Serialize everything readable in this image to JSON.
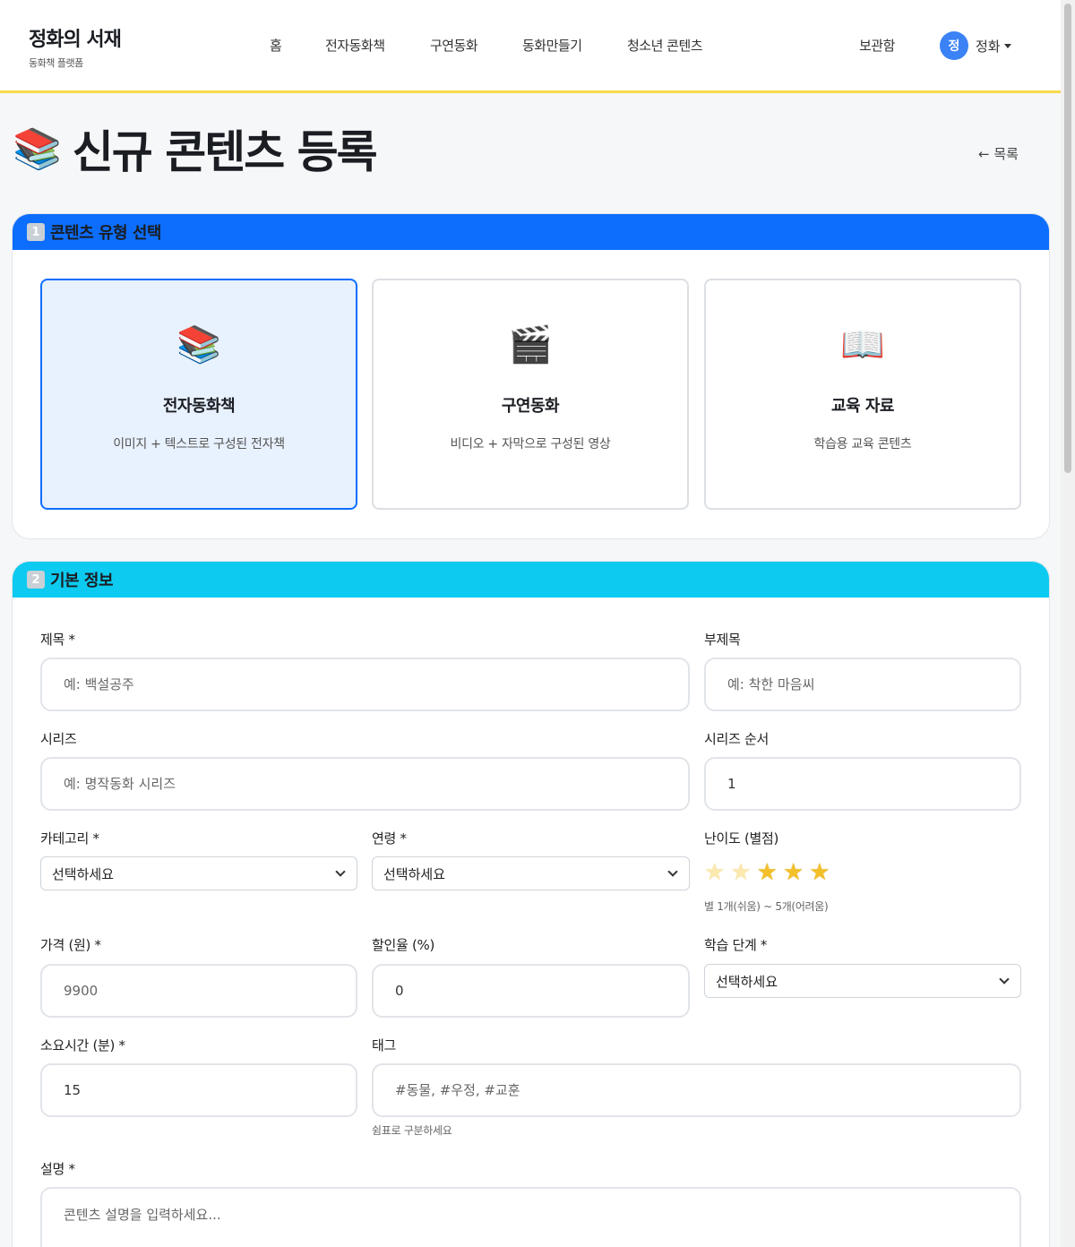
{
  "header": {
    "brand_title": "정화의 서재",
    "brand_subtitle": "동화책 플랫폼",
    "nav": [
      "홈",
      "전자동화책",
      "구연동화",
      "동화만들기",
      "청소년 콘텐츠"
    ],
    "storage": "보관함",
    "user_initial": "정",
    "user_name": "정화"
  },
  "page": {
    "title_icon": "📚",
    "title": "신규 콘텐츠 등록",
    "back_link": "← 목록"
  },
  "section1": {
    "number": "1",
    "title": "콘텐츠 유형 선택",
    "types": [
      {
        "icon": "📚",
        "title": "전자동화책",
        "desc": "이미지 + 텍스트로 구성된 전자책",
        "selected": true
      },
      {
        "icon": "🎬",
        "title": "구연동화",
        "desc": "비디오 + 자막으로 구성된 영상",
        "selected": false
      },
      {
        "icon": "📖",
        "title": "교육 자료",
        "desc": "학습용 교육 콘텐츠",
        "selected": false
      }
    ]
  },
  "section2": {
    "number": "2",
    "title": "기본 정보",
    "fields": {
      "title": {
        "label": "제목 *",
        "placeholder": "예: 백설공주"
      },
      "subtitle": {
        "label": "부제목",
        "placeholder": "예: 착한 마음씨"
      },
      "series": {
        "label": "시리즈",
        "placeholder": "예: 명작동화 시리즈"
      },
      "series_order": {
        "label": "시리즈 순서",
        "value": "1"
      },
      "category": {
        "label": "카테고리 *",
        "value": "선택하세요"
      },
      "age": {
        "label": "연령 *",
        "value": "선택하세요"
      },
      "difficulty": {
        "label": "난이도 (별점)",
        "rating": 3,
        "max": 5,
        "hint": "별 1개(쉬움) ~ 5개(어려움)"
      },
      "price": {
        "label": "가격 (원) *",
        "placeholder": "9900"
      },
      "discount": {
        "label": "할인율 (%)",
        "value": "0"
      },
      "level": {
        "label": "학습 단계 *",
        "value": "선택하세요"
      },
      "duration": {
        "label": "소요시간 (분) *",
        "value": "15"
      },
      "tags": {
        "label": "태그",
        "placeholder": "#동물, #우정, #교훈",
        "hint": "쉼표로 구분하세요"
      },
      "description": {
        "label": "설명 *",
        "placeholder": "콘텐츠 설명을 입력하세요..."
      }
    }
  },
  "colors": {
    "accent_blue": "#0d6efd",
    "accent_cyan": "#0dcaf0",
    "header_border": "#f7d94c",
    "star": "#f4c02a"
  }
}
